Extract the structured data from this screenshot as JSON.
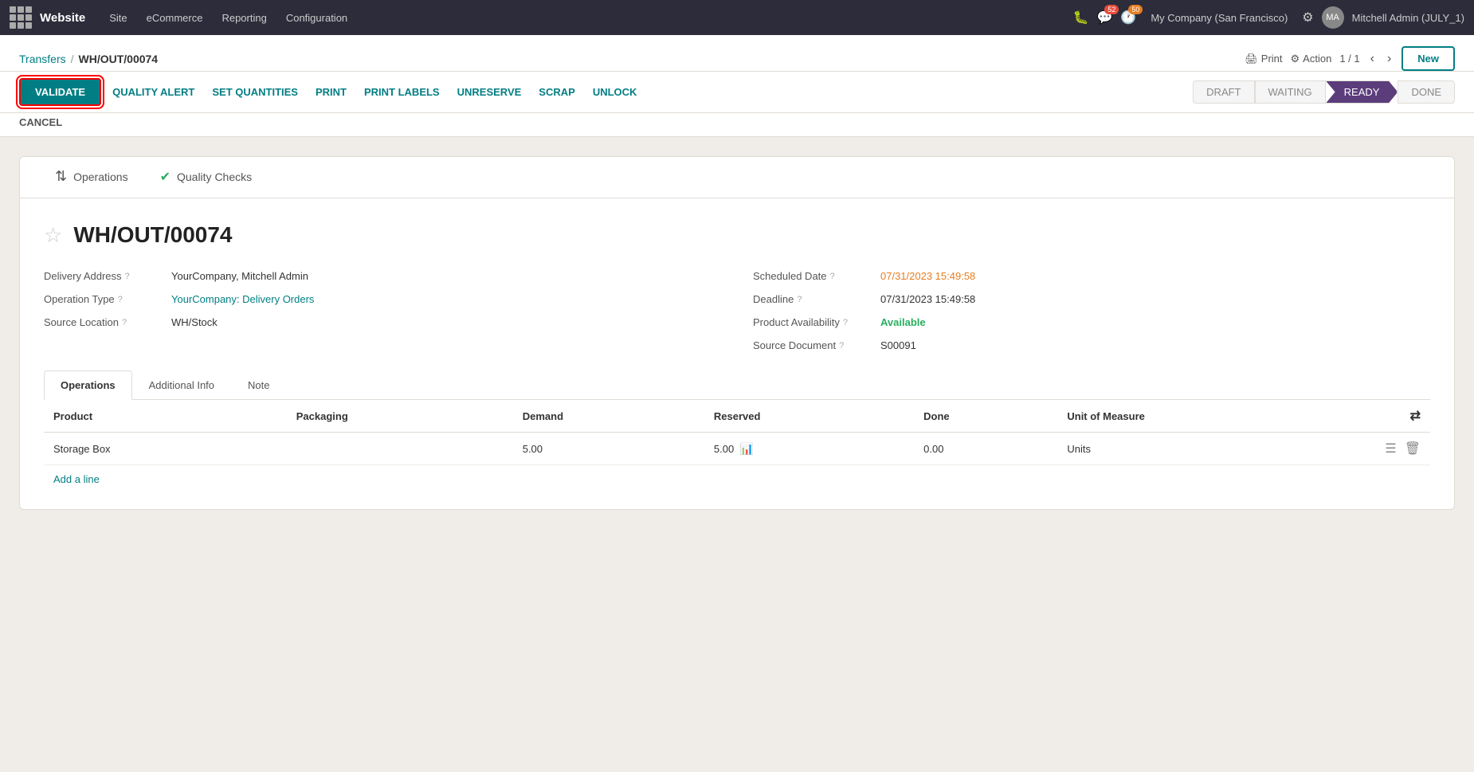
{
  "topnav": {
    "brand": "Website",
    "items": [
      "Site",
      "eCommerce",
      "Reporting",
      "Configuration"
    ],
    "msg_count": "52",
    "activity_count": "50",
    "company": "My Company (San Francisco)",
    "user": "Mitchell Admin (JULY_1)"
  },
  "breadcrumb": {
    "parent": "Transfers",
    "separator": "/",
    "current": "WH/OUT/00074",
    "print_label": "Print",
    "action_label": "Action",
    "pagination": "1 / 1",
    "new_label": "New"
  },
  "actionbar": {
    "validate": "VALIDATE",
    "quality_alert": "QUALITY ALERT",
    "set_quantities": "SET QUANTITIES",
    "print": "PRINT",
    "print_labels": "PRINT LABELS",
    "unreserve": "UNRESERVE",
    "scrap": "SCRAP",
    "unlock": "UNLOCK",
    "cancel": "CANCEL",
    "status_waiting": "WAITING",
    "status_ready": "READY",
    "status_done": "DONE",
    "status_draft": "DRAFT"
  },
  "card_tabs": {
    "operations_label": "Operations",
    "quality_checks_label": "Quality Checks"
  },
  "form": {
    "title": "WH/OUT/00074",
    "delivery_address_label": "Delivery Address",
    "delivery_address_value": "YourCompany, Mitchell Admin",
    "operation_type_label": "Operation Type",
    "operation_type_value": "YourCompany: Delivery Orders",
    "source_location_label": "Source Location",
    "source_location_value": "WH/Stock",
    "scheduled_date_label": "Scheduled Date",
    "scheduled_date_value": "07/31/2023 15:49:58",
    "deadline_label": "Deadline",
    "deadline_value": "07/31/2023 15:49:58",
    "product_availability_label": "Product Availability",
    "product_availability_value": "Available",
    "source_document_label": "Source Document",
    "source_document_value": "S00091"
  },
  "tabs": {
    "operations": "Operations",
    "additional_info": "Additional Info",
    "note": "Note"
  },
  "table": {
    "col_product": "Product",
    "col_packaging": "Packaging",
    "col_demand": "Demand",
    "col_reserved": "Reserved",
    "col_done": "Done",
    "col_uom": "Unit of Measure",
    "rows": [
      {
        "product": "Storage Box",
        "packaging": "",
        "demand": "5.00",
        "reserved": "5.00",
        "done": "0.00",
        "uom": "Units"
      }
    ],
    "add_line": "Add a line"
  }
}
